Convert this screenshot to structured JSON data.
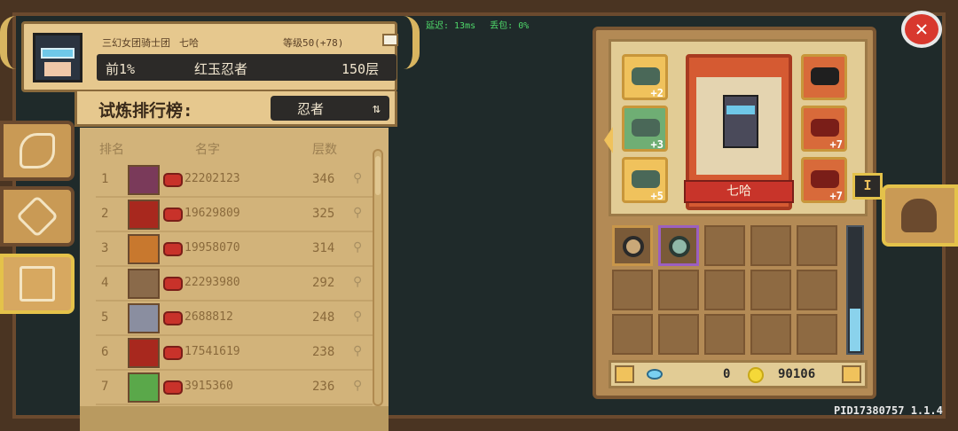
{
  "network": {
    "latency": "延迟: 13ms",
    "loss": "丢包: 0%"
  },
  "profile": {
    "guild": "三幻女团骑士团",
    "player_name": "七哈",
    "level": "等级50(+78)",
    "rank_percent": "前1%",
    "title": "红玉忍者",
    "floor": "150层"
  },
  "trial": {
    "title": "试炼排行榜:",
    "class_label": "忍者"
  },
  "ranking": {
    "headers": {
      "rank": "排名",
      "name": "名字",
      "floor": "层数"
    },
    "rows": [
      {
        "rank": "1",
        "player_id": "22202123",
        "floor": "346",
        "face_color": "#7a3a5a"
      },
      {
        "rank": "2",
        "player_id": "19629809",
        "floor": "325",
        "face_color": "#a8281e"
      },
      {
        "rank": "3",
        "player_id": "19958070",
        "floor": "314",
        "face_color": "#c8782e"
      },
      {
        "rank": "4",
        "player_id": "22293980",
        "floor": "292",
        "face_color": "#8a6a4a"
      },
      {
        "rank": "5",
        "player_id": "2688812",
        "floor": "248",
        "face_color": "#8a8ea0"
      },
      {
        "rank": "6",
        "player_id": "17541619",
        "floor": "238",
        "face_color": "#a8281e"
      },
      {
        "rank": "7",
        "player_id": "3915360",
        "floor": "236",
        "face_color": "#5aa84a"
      }
    ]
  },
  "equipment": {
    "character_name": "七哈",
    "slot_levels": {
      "left_top": "+2",
      "left_mid": "+3",
      "left_bottom": "+5",
      "right_mid": "+7",
      "right_bottom": "+7"
    },
    "tier_label": "I",
    "gems": "0",
    "coins": "90106"
  },
  "footer": {
    "pid_version": "PID17380757 1.1.4"
  },
  "colors": {
    "accent": "#e4c24a",
    "close_red": "#d8382e",
    "panel_tan": "#e6c88e"
  },
  "icons": [
    "close-icon",
    "feather-icon",
    "diamond-icon",
    "trophy-icon",
    "helmet-icon",
    "swap-icon",
    "lock-icon",
    "gem-icon",
    "coin-icon",
    "menu-icon"
  ]
}
